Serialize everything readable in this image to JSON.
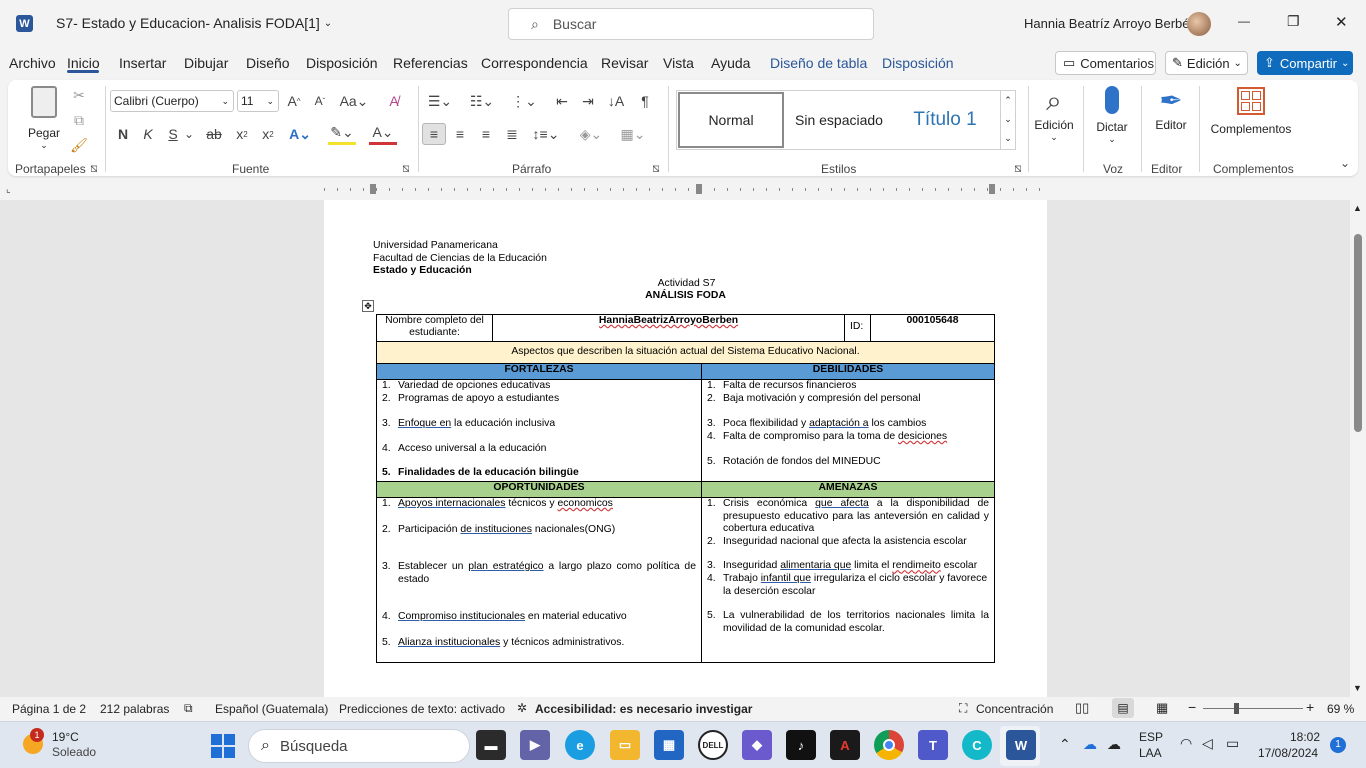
{
  "titlebar": {
    "doc_title": "S7- Estado y Educacion- Analisis FODA[1]",
    "search_placeholder": "Buscar",
    "user_name": "Hannia Beatríz Arroyo  Berbén",
    "minimize": "—",
    "maximize": "❐",
    "close": "✕"
  },
  "menu": {
    "items": [
      "Archivo",
      "Inicio",
      "Insertar",
      "Dibujar",
      "Diseño",
      "Disposición",
      "Referencias",
      "Correspondencia",
      "Revisar",
      "Vista",
      "Ayuda"
    ],
    "context_items": [
      "Diseño de tabla",
      "Disposición"
    ],
    "comments": "Comentarios",
    "editing": "Edición",
    "share": "Compartir"
  },
  "ribbon": {
    "clipboard": {
      "paste": "Pegar",
      "label": "Portapapeles"
    },
    "font": {
      "name": "Calibri (Cuerpo)",
      "size": "11",
      "label": "Fuente",
      "bold": "N",
      "italic": "K",
      "underline": "S"
    },
    "paragraph": {
      "label": "Párrafo"
    },
    "styles": {
      "items": [
        "Normal",
        "Sin espaciado",
        "Título 1"
      ],
      "label": "Estilos"
    },
    "editing": {
      "label_btn": "Edición"
    },
    "voice": {
      "dictate": "Dictar",
      "label": "Voz"
    },
    "editor": {
      "btn": "Editor",
      "label": "Editor"
    },
    "addins": {
      "btn": "Complementos",
      "label": "Complementos"
    }
  },
  "document": {
    "header_lines": [
      "Universidad Panamericana",
      "Facultad de Ciencias de la Educación"
    ],
    "header_bold": "Estado y Educación",
    "activity": "Actividad S7",
    "heading": "ANÁLISIS FODA",
    "student_label": "Nombre completo del estudiante:",
    "student_name": "HanniaBeatrizArroyoBerben",
    "id_label": "ID:",
    "id_value": "000105648",
    "aspects": "Aspectos que describen la situación actual del Sistema Educativo Nacional.",
    "fortalezas_title": "FORTALEZAS",
    "debilidades_title": "DEBILIDADES",
    "oportunidades_title": "OPORTUNIDADES",
    "amenazas_title": "AMENAZAS",
    "fortalezas": [
      "Variedad de opciones educativas",
      "Programas de apoyo a estudiantes",
      "Enfoque  en la educación  inclusiva",
      "Acceso universal a la educación",
      "Finalidades de la educación bilingüe"
    ],
    "debilidades": [
      "Falta de recursos financieros",
      "Baja motivación y compresión del personal",
      "Poca flexibilidad y adaptación  a los cambios",
      "Falta de compromiso para la toma de desiciones",
      "Rotación de fondos del MINEDUC"
    ],
    "oportunidades": [
      "Apoyos  internacionales  técnicos y economicos",
      "Participación  de  instituciones nacionales(ONG)",
      "Establecer un plan  estratégico  a largo plazo como  política de estado",
      "Compromiso  institucionales en material educativo",
      "Alianza institucionales y técnicos administrativos."
    ],
    "amenazas": [
      "Crisis económica que  afecta a la  disponibilidad de presupuesto educativo  para  las anteversión  en calidad  y cobertura educativa",
      "Inseguridad nacional que afecta la asistencia escolar",
      "Inseguridad alimentaria  que limita el rendimeito escolar",
      "Trabajo infantil  que irregulariza  el ciclo escolar  y favorece la deserción  escolar",
      "La vulnerabilidad  de los  territorios  nacionales  limita la movilidad de la comunidad escolar."
    ]
  },
  "status": {
    "page": "Página 1 de 2",
    "words": "212 palabras",
    "language": "Español (Guatemala)",
    "predictions": "Predicciones de texto: activado",
    "accessibility": "Accesibilidad: es necesario investigar",
    "focus": "Concentración",
    "zoom": "69 %"
  },
  "taskbar": {
    "weather_temp": "19°C",
    "weather_desc": "Soleado",
    "weather_badge": "1",
    "search": "Búsqueda",
    "lang1": "ESP",
    "lang2": "LAA",
    "time": "18:02",
    "date": "17/08/2024",
    "notif": "1"
  },
  "colors": {
    "accent": "#2b579a",
    "share": "#0f6cbd",
    "fortalezas": "#5b9bd5",
    "oportunidades": "#a9d18e",
    "aspects": "#fff2cc"
  }
}
